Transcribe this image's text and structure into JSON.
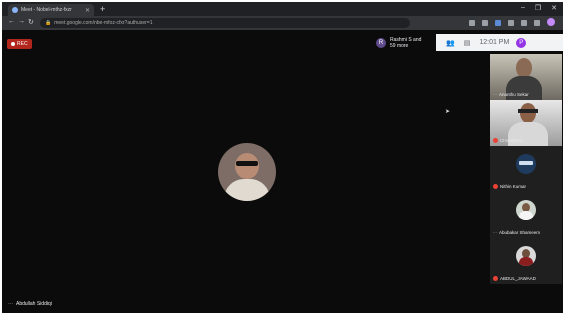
{
  "browser": {
    "tab_title": "Meet - Nobel-mthz-fxzr",
    "url": "meet.google.com/nbe-mfoz-cfxr?authuser=1",
    "new_tab_label": "+",
    "win_controls": [
      "–",
      "❐",
      "✕"
    ]
  },
  "meeting": {
    "rec_label": "REC",
    "presenter_initial": "R",
    "presenter_text": "Rashmi S and 59 more",
    "time": "12:01 PM",
    "self_initial": "P",
    "main_speaker": "Abdullah Siddiqi"
  },
  "participants": [
    {
      "name": "Ananthu Sekar",
      "muted": false
    },
    {
      "name": "Chiranjeevi ...",
      "muted": true
    },
    {
      "name": "Nithin Kumar",
      "muted": true
    },
    {
      "name": "Abubakar Shameem",
      "muted": false
    },
    {
      "name": "ABDUL_JAWAAD",
      "muted": true
    }
  ],
  "colors": {
    "rec_red": "#b3261e",
    "meet_bg": "#0b0b0b",
    "mute_red": "#ea4335"
  }
}
